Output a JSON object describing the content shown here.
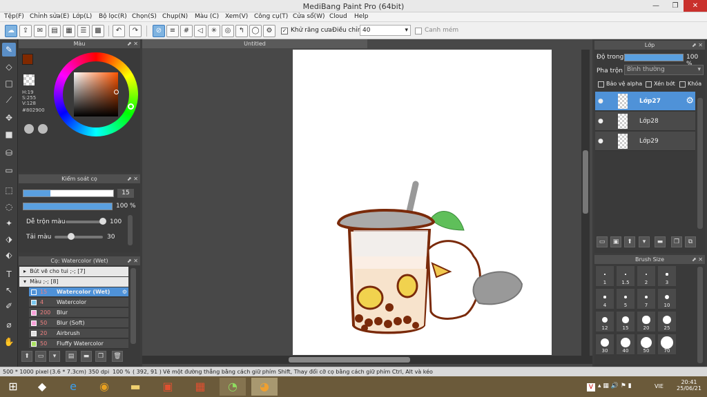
{
  "window": {
    "title": "MediBang Paint Pro (64bit)"
  },
  "menu": [
    "Tệp(F)",
    "Chỉnh sửa(E)",
    "Lớp(L)",
    "Bộ lọc(R)",
    "Chọn(S)",
    "Chụp(N)",
    "Màu (C)",
    "Xem(V)",
    "Công cụ(T)",
    "Cửa sổ(W)",
    "Cloud",
    "Help"
  ],
  "toolbar": {
    "antialias_label": "Khử răng cưa",
    "adjust_label": "Điều chỉnh",
    "adjust_value": "40",
    "ruler_label": "Canh mém"
  },
  "color_panel": {
    "title": "Màu",
    "h": "H:19",
    "s": "S:255",
    "v": "V:128",
    "hex": "#802900"
  },
  "brush_control": {
    "title": "Kiểm soát cọ",
    "size": "15",
    "opacity": "100 %",
    "blend_label": "Dễ trộn màu",
    "blend_value": "100",
    "reload_label": "Tải màu",
    "reload_value": "30"
  },
  "brush_panel": {
    "title": "Cọ: Watercolor (Wet)",
    "group1": "Bút vẽ cho tui ;-; [7]",
    "group2": "Màu ;-; [8]",
    "items": [
      {
        "size": "15",
        "name": "Watercolor (Wet)",
        "color": "#4f92d8"
      },
      {
        "size": "4",
        "name": "Watercolor",
        "color": "#7ac8f0"
      },
      {
        "size": "200",
        "name": "Blur",
        "color": "#f7a0d8"
      },
      {
        "size": "50",
        "name": "Blur (Soft)",
        "color": "#f7a0d8"
      },
      {
        "size": "20",
        "name": "Airbrush",
        "color": "#e0e0e0"
      },
      {
        "size": "50",
        "name": "Fluffy Watercolor",
        "color": "#a8e060"
      }
    ]
  },
  "canvas": {
    "tab": "Untitled"
  },
  "layer_panel": {
    "title": "Lớp",
    "opacity_label": "Độ trong",
    "opacity_value": "100 %",
    "blend_label": "Pha trộn",
    "blend_value": "Bình thường",
    "protect_alpha": "Bảo vệ alpha",
    "clip": "Xén bớt",
    "lock": "Khóa",
    "layers": [
      "Lớp27",
      "Lớp28",
      "Lớp29"
    ]
  },
  "brush_size": {
    "title": "Brush Size",
    "sizes": [
      "1",
      "1.5",
      "2",
      "3",
      "4",
      "5",
      "7",
      "10",
      "12",
      "15",
      "20",
      "25",
      "30",
      "40",
      "50",
      "70"
    ]
  },
  "status": {
    "dims": "500 * 1000 pixel",
    "cm": "(3.6 * 7.3cm)",
    "dpi": "350 dpi",
    "zoom": "100 %",
    "coords": "( 392, 91 )",
    "hint": "Vẽ một đường thẳng bằng cách giữ phím Shift, Thay đổi cỡ cọ bằng cách giữ phím Ctrl, Alt và kéo"
  },
  "taskbar": {
    "lang": "VIE",
    "time": "20:41",
    "date": "25/06/21"
  }
}
